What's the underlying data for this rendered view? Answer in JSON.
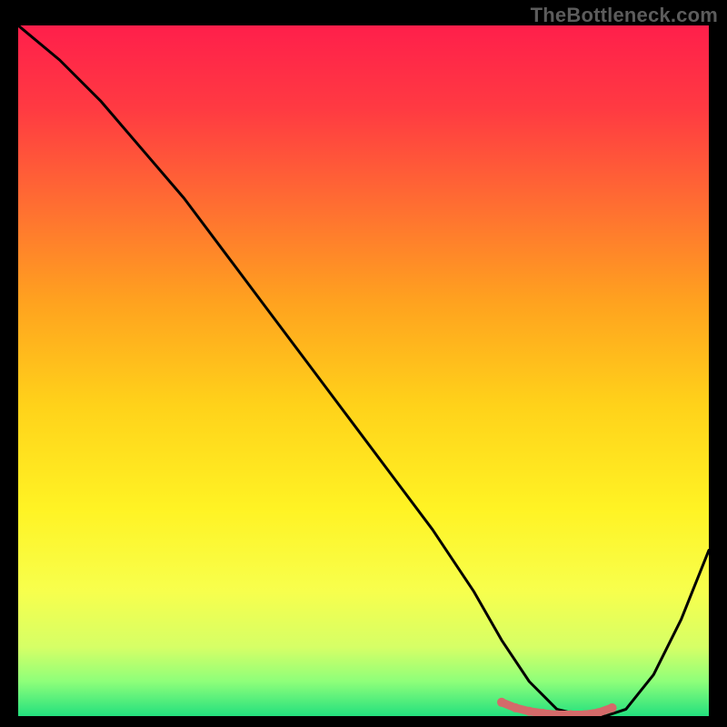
{
  "watermark": "TheBottleneck.com",
  "chart_data": {
    "type": "line",
    "title": "",
    "xlabel": "",
    "ylabel": "",
    "xlim": [
      0,
      100
    ],
    "ylim": [
      0,
      100
    ],
    "grid": false,
    "legend": false,
    "gradient_stops": [
      {
        "offset": 0,
        "color": "#ff1f4b"
      },
      {
        "offset": 12,
        "color": "#ff3a42"
      },
      {
        "offset": 25,
        "color": "#ff6a33"
      },
      {
        "offset": 40,
        "color": "#ffa21f"
      },
      {
        "offset": 55,
        "color": "#ffd21a"
      },
      {
        "offset": 70,
        "color": "#fff324"
      },
      {
        "offset": 82,
        "color": "#f7ff4d"
      },
      {
        "offset": 90,
        "color": "#d6ff66"
      },
      {
        "offset": 95,
        "color": "#8eff7a"
      },
      {
        "offset": 100,
        "color": "#23e07e"
      }
    ],
    "series": [
      {
        "name": "bottleneck-curve",
        "color": "#000000",
        "x": [
          0,
          6,
          12,
          18,
          24,
          30,
          36,
          42,
          48,
          54,
          60,
          66,
          70,
          74,
          78,
          82,
          85,
          88,
          92,
          96,
          100
        ],
        "values": [
          100,
          95,
          89,
          82,
          75,
          67,
          59,
          51,
          43,
          35,
          27,
          18,
          11,
          5,
          1,
          0,
          0,
          1,
          6,
          14,
          24
        ]
      },
      {
        "name": "optimal-band",
        "color": "#d46a6a",
        "x": [
          70,
          72,
          74,
          76,
          78,
          80,
          82,
          84,
          86
        ],
        "values": [
          2.0,
          1.2,
          0.7,
          0.4,
          0.2,
          0.2,
          0.2,
          0.5,
          1.2
        ]
      }
    ],
    "optimal_range": {
      "x_min": 70,
      "x_max": 86
    }
  }
}
